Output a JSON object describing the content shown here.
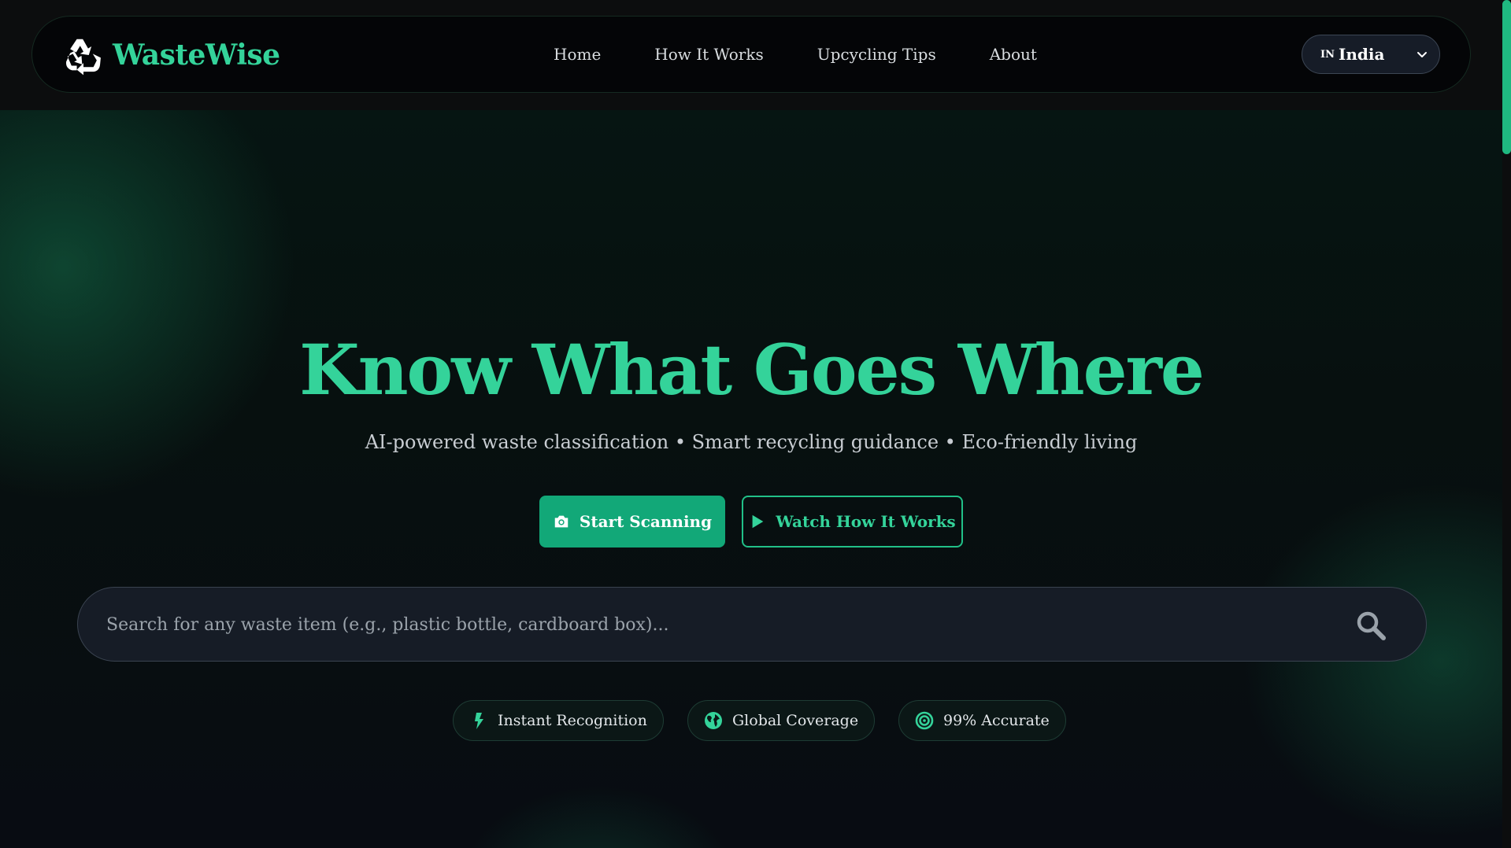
{
  "brand": {
    "name": "WasteWise",
    "icon": "recycle-icon",
    "accent_color": "#34d39a"
  },
  "nav": {
    "links": [
      "Home",
      "How It Works",
      "Upcycling Tips",
      "About"
    ],
    "country": {
      "code": "IN",
      "name": "India"
    }
  },
  "hero": {
    "headline": "Know What Goes Where",
    "subtitle": "AI-powered waste classification • Smart recycling guidance • Eco-friendly living",
    "primary_button": {
      "label": "Start Scanning",
      "icon": "camera-icon"
    },
    "secondary_button": {
      "label": "Watch How It Works",
      "icon": "play-icon"
    }
  },
  "search": {
    "placeholder": "Search for any waste item (e.g., plastic bottle, cardboard box)...",
    "value": ""
  },
  "features": [
    {
      "label": "Instant Recognition",
      "icon": "bolt-icon"
    },
    {
      "label": "Global Coverage",
      "icon": "globe-icon"
    },
    {
      "label": "99% Accurate",
      "icon": "target-icon"
    }
  ]
}
